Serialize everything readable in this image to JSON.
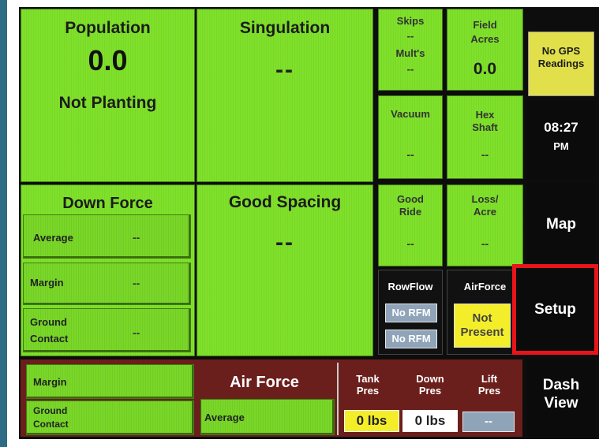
{
  "population": {
    "title": "Population",
    "value": "0.0",
    "status": "Not Planting"
  },
  "singulation": {
    "title": "Singulation",
    "value": "--"
  },
  "skips": {
    "title": "Skips",
    "value": "--"
  },
  "mults": {
    "title": "Mult's",
    "value": "--"
  },
  "field_acres": {
    "title_line1": "Field",
    "title_line2": "Acres",
    "value": "0.0"
  },
  "gps": {
    "line1": "No GPS",
    "line2": "Readings"
  },
  "vacuum": {
    "title": "Vacuum",
    "value": "--"
  },
  "hex_shaft": {
    "title_line1": "Hex",
    "title_line2": "Shaft",
    "value": "--"
  },
  "clock": {
    "time": "08:27",
    "ampm": "PM"
  },
  "down_force": {
    "title": "Down Force",
    "rows": [
      {
        "label": "Average",
        "value": "--"
      },
      {
        "label": "Margin",
        "value": "--"
      },
      {
        "label_line1": "Ground",
        "label_line2": "Contact",
        "value": "--"
      }
    ]
  },
  "good_spacing": {
    "title": "Good Spacing",
    "value": "--"
  },
  "good_ride": {
    "title_line1": "Good",
    "title_line2": "Ride",
    "value": "--"
  },
  "loss_acre": {
    "title_line1": "Loss/",
    "title_line2": "Acre",
    "value": "--"
  },
  "nav": {
    "map": "Map",
    "setup": "Setup",
    "dash_line1": "Dash",
    "dash_line2": "View"
  },
  "rowflow": {
    "title": "RowFlow",
    "btn1": "No RFM",
    "btn2": "No RFM"
  },
  "airforce_tile": {
    "title": "AirForce",
    "line1": "Not",
    "line2": "Present"
  },
  "bottom": {
    "margin_label": "Margin",
    "ground_line1": "Ground",
    "ground_line2": "Contact",
    "air_force_title": "Air Force",
    "average_label": "Average",
    "tank": {
      "line1": "Tank",
      "line2": "Pres",
      "value": "0 lbs"
    },
    "down": {
      "line1": "Down",
      "line2": "Pres",
      "value": "0 lbs"
    },
    "lift": {
      "line1": "Lift",
      "line2": "Pres",
      "value": "--"
    }
  },
  "colors": {
    "tile_green": "#7fe12a",
    "highlight_red": "#e8141b",
    "gps_yellow": "#e2e04a",
    "maroon": "#6b1f1c"
  }
}
